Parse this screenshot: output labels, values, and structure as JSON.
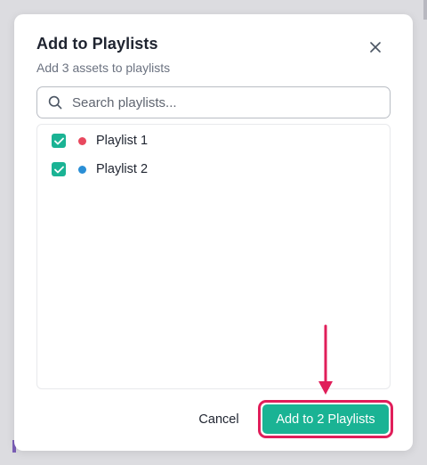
{
  "dialog": {
    "title": "Add to Playlists",
    "subtitle": "Add 3 assets to playlists",
    "close_icon": "close-icon"
  },
  "search": {
    "placeholder": "Search playlists...",
    "value": "",
    "icon": "search-icon"
  },
  "playlists": [
    {
      "label": "Playlist 1",
      "checked": true,
      "color": "#e8485e"
    },
    {
      "label": "Playlist 2",
      "checked": true,
      "color": "#2a8fd6"
    }
  ],
  "footer": {
    "cancel_label": "Cancel",
    "confirm_label": "Add to 2 Playlists"
  },
  "colors": {
    "accent": "#1ab394",
    "highlight": "#e01e5a"
  }
}
